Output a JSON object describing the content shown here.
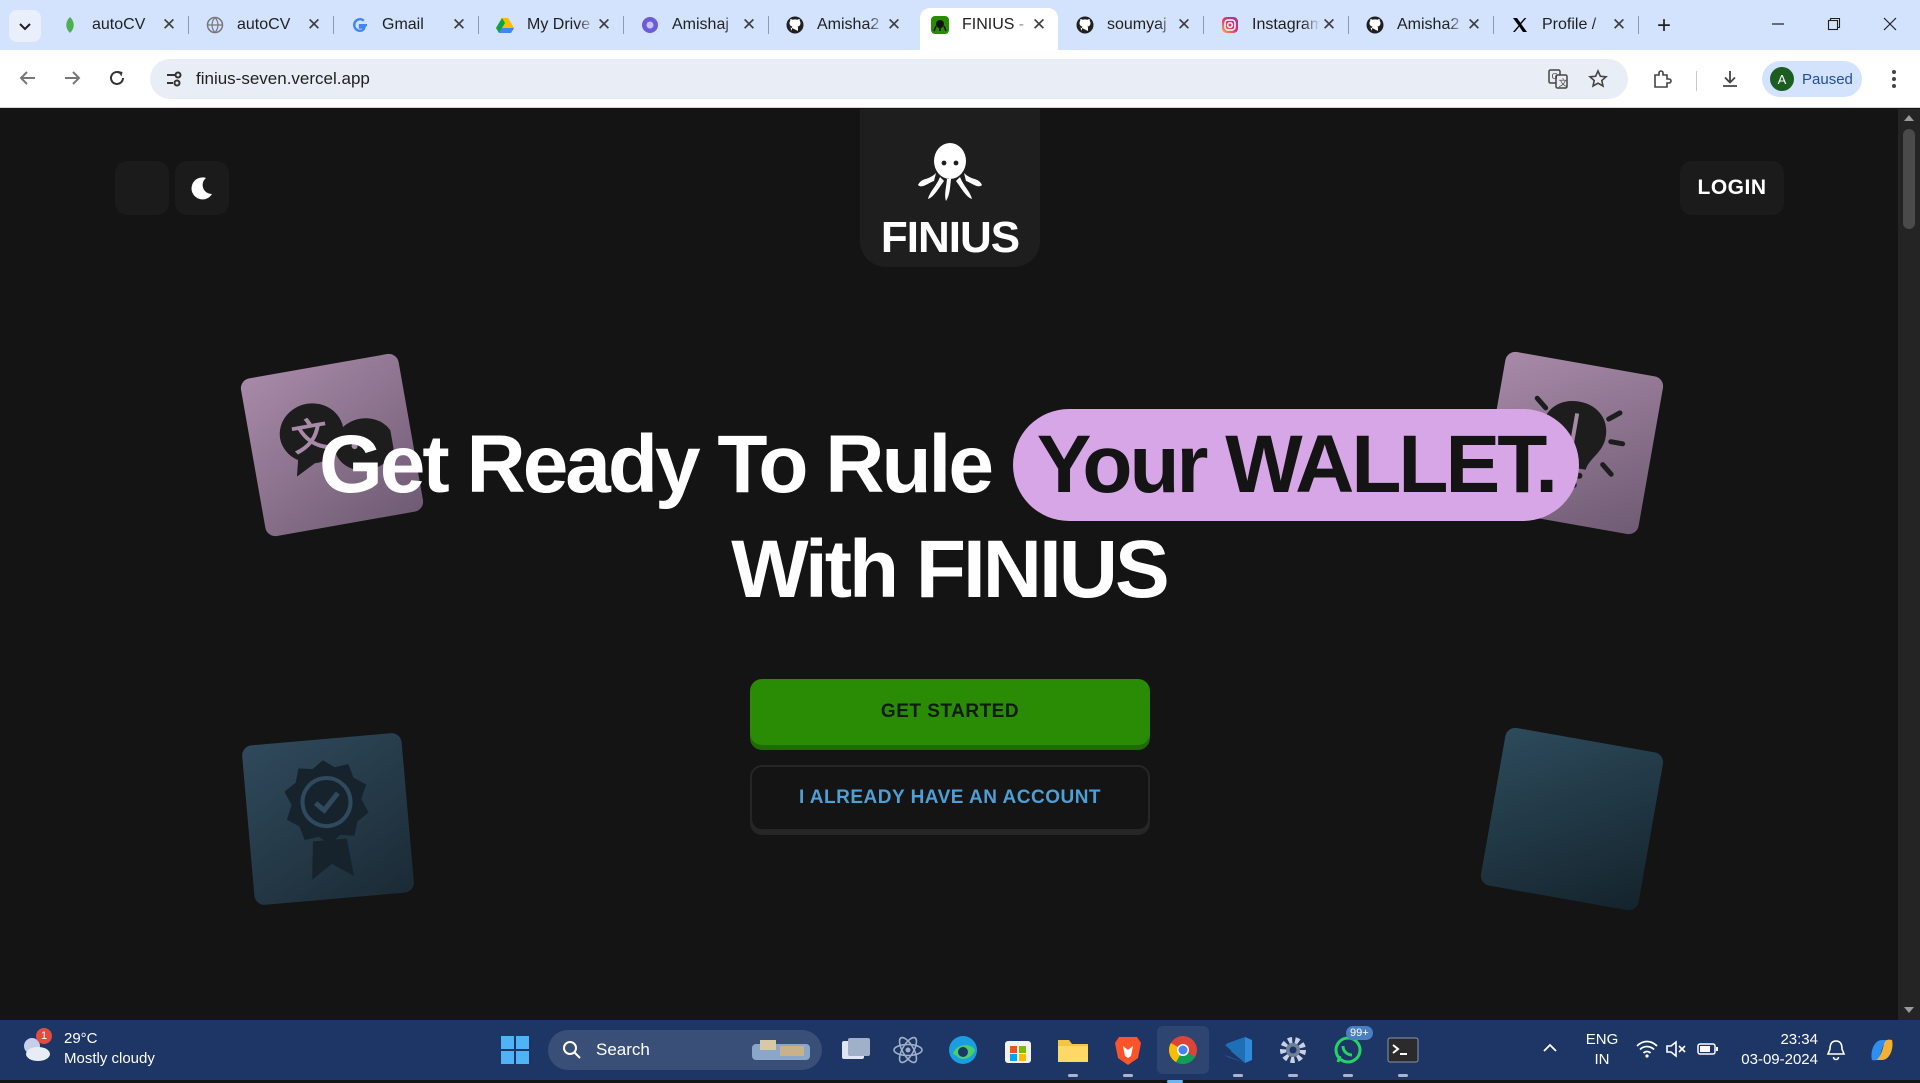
{
  "browser": {
    "tabs": [
      {
        "label": "autoCV",
        "icon": "autocv-icon",
        "active": false
      },
      {
        "label": "autoCV",
        "icon": "globe-icon",
        "active": false
      },
      {
        "label": "Gmail",
        "icon": "google-icon",
        "active": false
      },
      {
        "label": "My Drive",
        "icon": "drive-icon",
        "active": false
      },
      {
        "label": "Amishaj",
        "icon": "app-icon",
        "active": false
      },
      {
        "label": "Amisha2",
        "icon": "github-icon",
        "active": false
      },
      {
        "label": "FINIUS -",
        "icon": "finius-icon",
        "active": true
      },
      {
        "label": "soumyaj",
        "icon": "github-icon",
        "active": false
      },
      {
        "label": "Instagram",
        "icon": "instagram-icon",
        "active": false
      },
      {
        "label": "Amisha2",
        "icon": "github-icon",
        "active": false
      },
      {
        "label": "Profile /",
        "icon": "x-icon",
        "active": false
      }
    ],
    "url": "finius-seven.vercel.app",
    "profile_status": "Paused",
    "profile_initial": "A"
  },
  "page": {
    "login_label": "LOGIN",
    "brand": "FINIUS",
    "headline_part1": "Get Ready To Rule",
    "headline_highlight": "Your WALLET.",
    "headline_line2": "With FINIUS",
    "cta_primary": "GET STARTED",
    "cta_secondary": "I ALREADY HAVE AN ACCOUNT",
    "colors": {
      "highlight": "#d7a6e6",
      "primary_button": "#2a8c05",
      "secondary_text": "#4d9fd6",
      "background": "#141414"
    }
  },
  "taskbar": {
    "weather_temp": "29°C",
    "weather_condition": "Mostly cloudy",
    "weather_badge": "1",
    "search_placeholder": "Search",
    "whatsapp_badge": "99+",
    "lang_top": "ENG",
    "lang_bottom": "IN",
    "time": "23:34",
    "date": "03-09-2024"
  }
}
